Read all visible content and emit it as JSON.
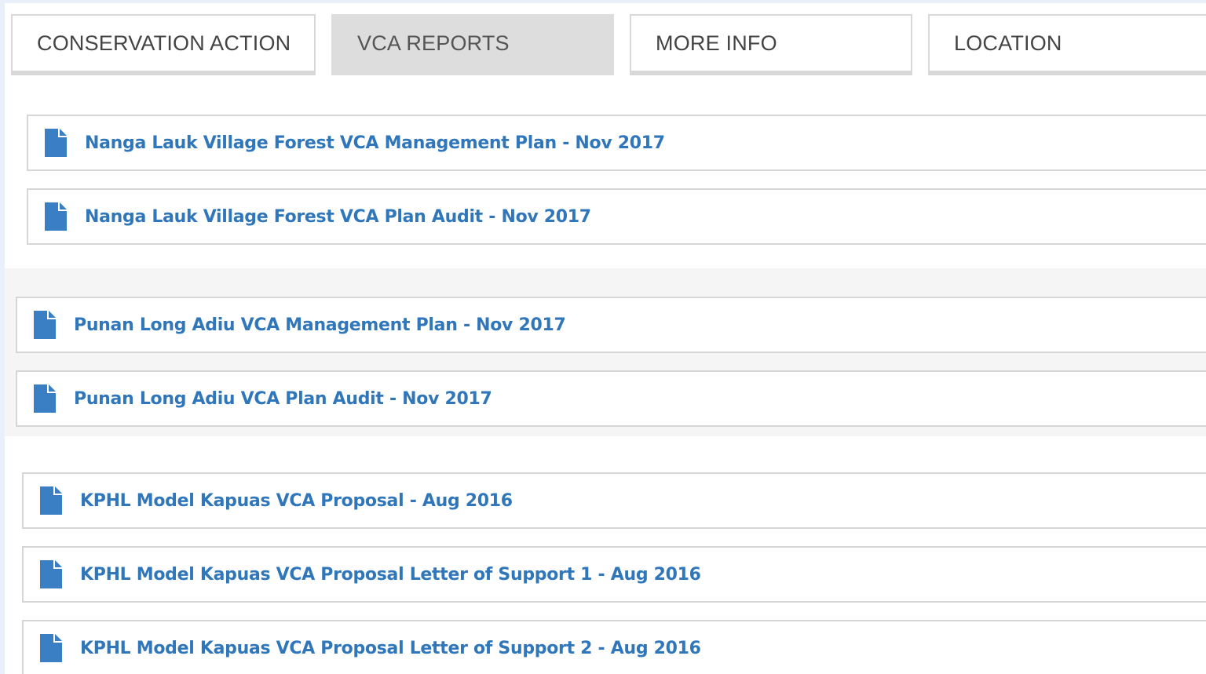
{
  "tabs": [
    {
      "label": "CONSERVATION ACTION",
      "active": false
    },
    {
      "label": "VCA REPORTS",
      "active": true
    },
    {
      "label": "MORE INFO",
      "active": false
    },
    {
      "label": "LOCATION",
      "active": false
    }
  ],
  "colors": {
    "link": "#2f76bb",
    "icon": "#3a7fc3",
    "tab_active_bg": "#dddddd",
    "border": "#d6d6d6"
  },
  "icon": "file-icon",
  "groups": [
    {
      "documents": [
        {
          "title": "Nanga Lauk Village Forest VCA Management Plan - Nov 2017"
        },
        {
          "title": "Nanga Lauk Village Forest VCA Plan Audit - Nov 2017"
        }
      ]
    },
    {
      "documents": [
        {
          "title": "Punan Long Adiu VCA Management Plan - Nov 2017"
        },
        {
          "title": "Punan Long Adiu VCA Plan Audit - Nov 2017"
        }
      ]
    },
    {
      "documents": [
        {
          "title": "KPHL Model Kapuas VCA Proposal - Aug 2016"
        },
        {
          "title": "KPHL Model Kapuas VCA Proposal Letter of Support 1 - Aug 2016"
        },
        {
          "title": "KPHL Model Kapuas VCA Proposal Letter of Support 2 - Aug 2016"
        }
      ]
    }
  ]
}
